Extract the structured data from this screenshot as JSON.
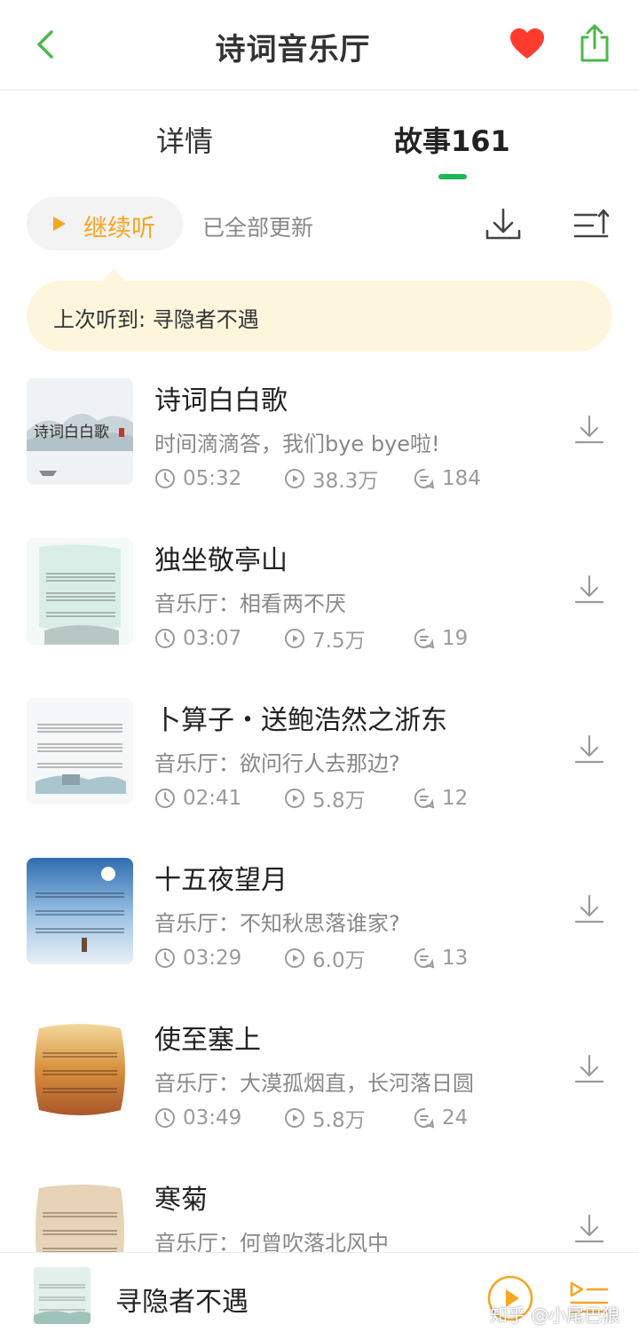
{
  "header": {
    "title": "诗词音乐厅",
    "colors": {
      "accent": "#4cb84a",
      "heart": "#ff3b30"
    }
  },
  "tabs": [
    {
      "label": "详情",
      "active": false
    },
    {
      "label": "故事161",
      "active": true
    }
  ],
  "toolbar": {
    "continue_label": "继续听",
    "update_status": "已全部更新"
  },
  "tip": {
    "text": "上次听到: 寻隐者不遇"
  },
  "episodes": [
    {
      "title": "诗词白白歌",
      "desc": "时间滴滴答，我们bye bye啦!",
      "duration": "05:32",
      "plays": "38.3万",
      "comments": "184",
      "cover_art": "诗词白白歌"
    },
    {
      "title": "独坐敬亭山",
      "desc": "音乐厅：相看两不厌",
      "duration": "03:07",
      "plays": "7.5万",
      "comments": "19"
    },
    {
      "title": "卜算子・送鲍浩然之浙东",
      "desc": "音乐厅：欲问行人去那边?",
      "duration": "02:41",
      "plays": "5.8万",
      "comments": "12"
    },
    {
      "title": "十五夜望月",
      "desc": "音乐厅：不知秋思落谁家?",
      "duration": "03:29",
      "plays": "6.0万",
      "comments": "13"
    },
    {
      "title": "使至塞上",
      "desc": "音乐厅：大漠孤烟直，长河落日圆",
      "duration": "03:49",
      "plays": "5.8万",
      "comments": "24"
    },
    {
      "title": "寒菊",
      "desc": "音乐厅：何曾吹落北风中"
    }
  ],
  "player": {
    "title": "寻隐者不遇"
  },
  "watermark": "知乎 @小尾巴狼"
}
